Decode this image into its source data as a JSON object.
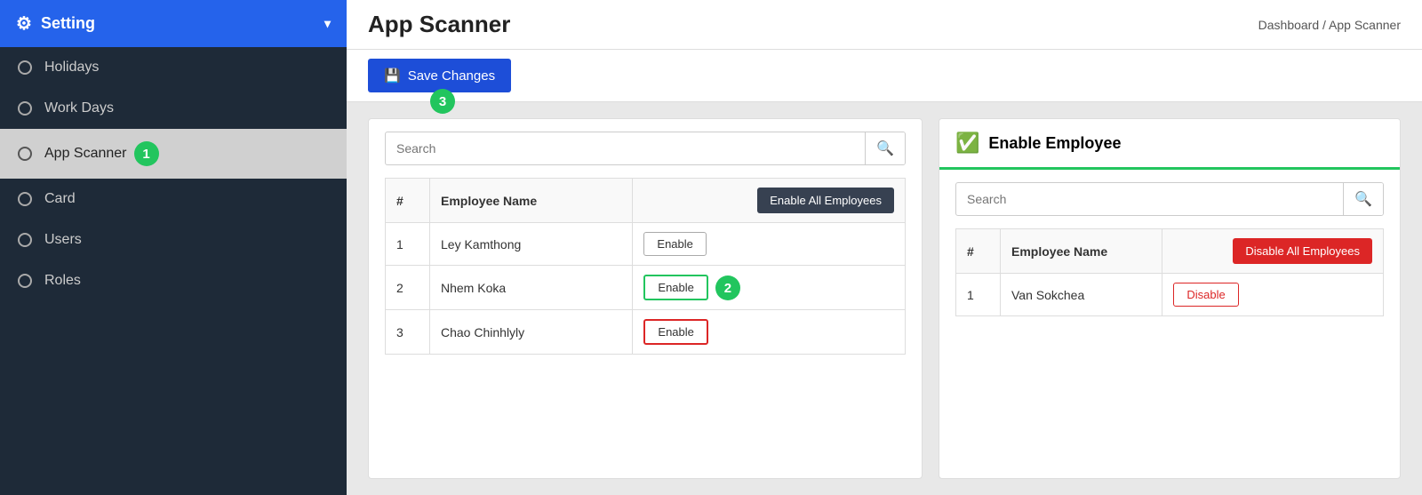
{
  "sidebar": {
    "header_label": "Setting",
    "items": [
      {
        "id": "holidays",
        "label": "Holidays",
        "active": false
      },
      {
        "id": "workdays",
        "label": "Work Days",
        "active": false
      },
      {
        "id": "appscanner",
        "label": "App Scanner",
        "active": true
      },
      {
        "id": "card",
        "label": "Card",
        "active": false
      },
      {
        "id": "users",
        "label": "Users",
        "active": false
      },
      {
        "id": "roles",
        "label": "Roles",
        "active": false
      }
    ]
  },
  "page_title": "App Scanner",
  "breadcrumb": {
    "home": "Dashboard",
    "separator": " / ",
    "current": "App Scanner"
  },
  "toolbar": {
    "save_label": "Save Changes"
  },
  "left_panel": {
    "search_placeholder": "Search",
    "table_col_num": "#",
    "table_col_name": "Employee Name",
    "enable_all_label": "Enable All Employees",
    "rows": [
      {
        "num": 1,
        "name": "Ley Kamthong",
        "btn_label": "Enable",
        "style": "normal"
      },
      {
        "num": 2,
        "name": "Nhem Koka",
        "btn_label": "Enable",
        "style": "highlighted"
      },
      {
        "num": 3,
        "name": "Chao Chinhlyly",
        "btn_label": "Enable",
        "style": "red-border"
      }
    ]
  },
  "right_panel": {
    "header_label": "Enable Employee",
    "search_placeholder": "Search",
    "table_col_num": "#",
    "table_col_name": "Employee Name",
    "disable_all_label": "Disable All Employees",
    "rows": [
      {
        "num": 1,
        "name": "Van Sokchea",
        "btn_label": "Disable"
      }
    ]
  },
  "step_badges": {
    "badge1": "1",
    "badge2": "2",
    "badge3": "3"
  }
}
